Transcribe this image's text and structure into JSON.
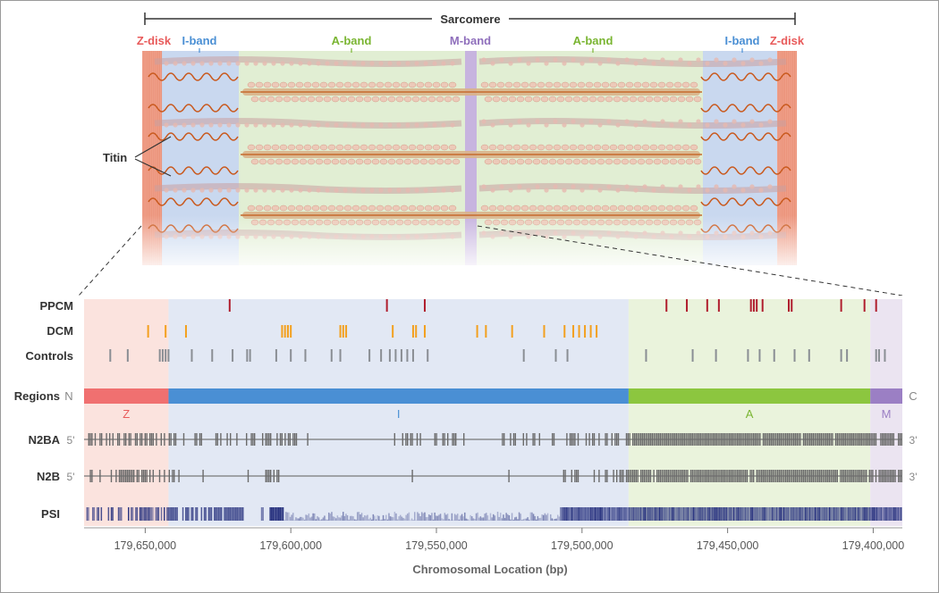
{
  "sarcomere": {
    "title": "Sarcomere",
    "titin_label": "Titin",
    "bands": {
      "zdisk_left": "Z-disk",
      "iband_left": "I-band",
      "aband_left": "A-band",
      "mband": "M-band",
      "aband_right": "A-band",
      "iband_right": "I-band",
      "zdisk_right": "Z-disk"
    }
  },
  "tracks": {
    "ppcm": "PPCM",
    "dcm": "DCM",
    "controls": "Controls",
    "regions": "Regions",
    "n2ba": "N2BA",
    "n2b": "N2B",
    "psi": "PSI",
    "n_term": "N",
    "c_term": "C",
    "five_prime": "5'",
    "three_prime": "3'"
  },
  "regions": [
    {
      "label": "Z",
      "start": 179672000,
      "end": 179642000,
      "color": "#f07070",
      "text_color": "#e85a5a"
    },
    {
      "label": "I",
      "start": 179642000,
      "end": 179484000,
      "color": "#4a8fd4",
      "text_color": "#4a8fd4"
    },
    {
      "label": "A",
      "start": 179484000,
      "end": 179401000,
      "color": "#8cc63f",
      "text_color": "#7ab532"
    },
    {
      "label": "M",
      "start": 179401000,
      "end": 179390000,
      "color": "#9b7fc4",
      "text_color": "#9b7fc4"
    }
  ],
  "axis": {
    "label": "Chromosomal Location (bp)",
    "ticks": [
      "179,650,000",
      "179,600,000",
      "179,550,000",
      "179,500,000",
      "179,450,000",
      "179,400,000"
    ],
    "tick_values": [
      179650000,
      179600000,
      179550000,
      179500000,
      179450000,
      179400000
    ],
    "domain": [
      179671000,
      179390000
    ]
  },
  "variants": {
    "ppcm": [
      179621000,
      179567000,
      179554000,
      179471000,
      179464000,
      179457000,
      179453000,
      179442000,
      179441000,
      179440000,
      179438000,
      179429000,
      179428000,
      179411000,
      179403000,
      179399000
    ],
    "dcm": [
      179649000,
      179643000,
      179636000,
      179603000,
      179602000,
      179601000,
      179601000,
      179600000,
      179583000,
      179582000,
      179581000,
      179565000,
      179557000,
      179558000,
      179554000,
      179536000,
      179533000,
      179524000,
      179513000,
      179506000,
      179503000,
      179501000,
      179499000,
      179497000,
      179495000
    ],
    "controls": [
      179662000,
      179656000,
      179645000,
      179644000,
      179643000,
      179642000,
      179634000,
      179627000,
      179620000,
      179615000,
      179614000,
      179605000,
      179600000,
      179595000,
      179586000,
      179583000,
      179573000,
      179569000,
      179566000,
      179564000,
      179562000,
      179560000,
      179558000,
      179553000,
      179520000,
      179509000,
      179505000,
      179478000,
      179462000,
      179454000,
      179443000,
      179439000,
      179434000,
      179427000,
      179422000,
      179411000,
      179409000,
      179399000,
      179398000,
      179396000
    ]
  },
  "colors": {
    "ppcm": "#b01e2e",
    "dcm": "#f3a01e",
    "controls": "#8a8e94",
    "exon": "#6b6b6b",
    "psi": "#2a3480"
  }
}
